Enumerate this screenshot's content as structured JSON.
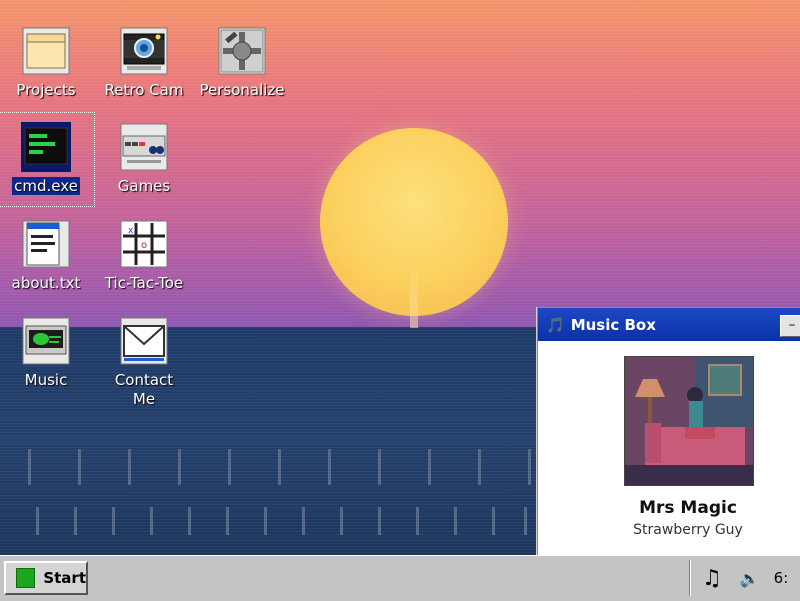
{
  "desktop": {
    "icons": [
      {
        "label": "Projects",
        "icon": "folder-icon"
      },
      {
        "label": "Retro Cam",
        "icon": "camera-icon"
      },
      {
        "label": "Personalize",
        "icon": "settings-icon"
      },
      {
        "label": "cmd.exe",
        "icon": "terminal-icon",
        "selected": true
      },
      {
        "label": "Games",
        "icon": "game-console-icon"
      },
      {
        "label": "about.txt",
        "icon": "text-file-icon"
      },
      {
        "label": "Tic-Tac-Toe",
        "icon": "tic-tac-toe-icon"
      },
      {
        "label": "Music",
        "icon": "music-player-icon"
      },
      {
        "label": "Contact Me",
        "icon": "envelope-icon"
      }
    ]
  },
  "music_window": {
    "title": "Music Box",
    "minimize_label": "–",
    "song_title": "Mrs Magic",
    "artist": "Strawberry Guy"
  },
  "taskbar": {
    "start_label": "Start",
    "clock": "6:"
  },
  "colors": {
    "titlebar": "#0a32a8",
    "start_logo": "#1ea51e",
    "taskbar": "#c4c4c4"
  }
}
